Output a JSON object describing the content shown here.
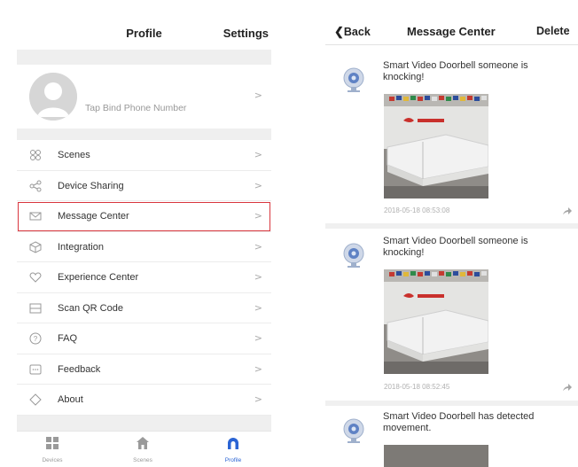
{
  "profile": {
    "title": "Profile",
    "settings_label": "Settings",
    "bind_phone_text": "Tap Bind Phone Number",
    "menu": [
      {
        "label": "Scenes",
        "icon": "scenes-icon"
      },
      {
        "label": "Device Sharing",
        "icon": "share-icon"
      },
      {
        "label": "Message Center",
        "icon": "envelope-icon",
        "selected": true
      },
      {
        "label": "Integration",
        "icon": "cube-icon"
      },
      {
        "label": "Experience Center",
        "icon": "heart-icon"
      },
      {
        "label": "Scan QR Code",
        "icon": "scan-icon"
      },
      {
        "label": "FAQ",
        "icon": "question-icon"
      },
      {
        "label": "Feedback",
        "icon": "feedback-icon"
      },
      {
        "label": "About",
        "icon": "diamond-icon"
      }
    ],
    "tabs": [
      {
        "label": "Devices",
        "icon": "grid-icon"
      },
      {
        "label": "Scenes",
        "icon": "house-icon"
      },
      {
        "label": "Profile",
        "icon": "profile-icon",
        "active": true
      }
    ]
  },
  "message_center": {
    "back_label": "Back",
    "title": "Message Center",
    "delete_label": "Delete",
    "messages": [
      {
        "text": "Smart  Video Doorbell someone is knocking!",
        "time": "2018-05-18 08:53:08"
      },
      {
        "text": "Smart  Video Doorbell someone is knocking!",
        "time": "2018-05-18 08:52:45"
      },
      {
        "text": "Smart  Video Doorbell has detected movement.",
        "time": ""
      }
    ]
  },
  "colors": {
    "accent_blue": "#2b64d4",
    "selection_red": "#d9363e",
    "section_gray": "#efefef"
  }
}
